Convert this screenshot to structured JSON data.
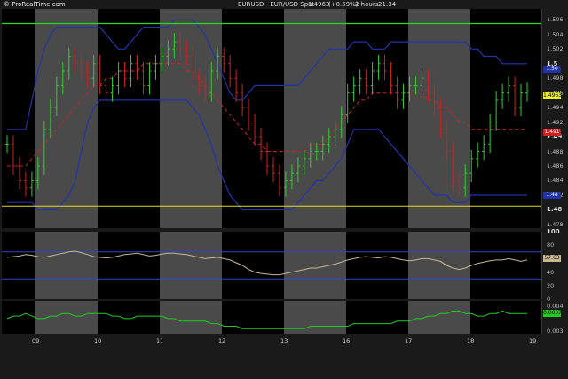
{
  "header": {
    "watermark": "© ProRealTime.com",
    "symbol": "EURUSD - EUR/USD Spot",
    "last": "1.4963",
    "change": "(+0.59%)",
    "timeframe": "2 hours",
    "time": "21:34"
  },
  "price_axis": {
    "ticks": [
      "1.506",
      "1.504",
      "1.502",
      "1.5",
      "1.498",
      "1.496",
      "1.494",
      "1.492",
      "1.49",
      "1.488",
      "1.486",
      "1.484",
      "1.482",
      "1.48",
      "1.478"
    ],
    "badges": {
      "upper_band": "1.50",
      "last": "1.4963",
      "ma": "1.491",
      "lower_band": "1.48"
    }
  },
  "osc1_axis": {
    "ticks": [
      "100",
      "80",
      "60",
      "40",
      "20",
      "0"
    ],
    "badge": "57.63"
  },
  "osc2_axis": {
    "ticks": [
      "0.004",
      "0.003"
    ],
    "badge": "0.0037"
  },
  "x_axis": {
    "labels": [
      "09",
      "10",
      "11",
      "12",
      "13",
      "16",
      "17",
      "18",
      "19"
    ]
  },
  "colors": {
    "background": "#000000",
    "session_band": "#4a4a4a",
    "up_candle": "#33cc33",
    "down_candle": "#cc2222",
    "bollinger": "#2233aa",
    "moving_average": "#cc2222",
    "oscillator": "#c8b890",
    "momentum": "#22cc22",
    "hline_green": "#22dd22",
    "hline_yellow": "#dddd22"
  },
  "chart_data": {
    "type": "line",
    "title": "EURUSD - EUR/USD Spot",
    "ylim": [
      1.4775,
      1.5075
    ],
    "days": [
      "09",
      "10",
      "11",
      "12",
      "13",
      "16",
      "17",
      "18",
      "19"
    ],
    "close": [
      1.489,
      1.486,
      1.484,
      1.483,
      1.484,
      1.486,
      1.491,
      1.494,
      1.497,
      1.499,
      1.501,
      1.5,
      1.499,
      1.498,
      1.5,
      1.497,
      1.496,
      1.497,
      1.499,
      1.498,
      1.5,
      1.499,
      1.497,
      1.499,
      1.5,
      1.501,
      1.502,
      1.503,
      1.502,
      1.501,
      1.498,
      1.497,
      1.496,
      1.499,
      1.501,
      1.5,
      1.498,
      1.496,
      1.494,
      1.492,
      1.49,
      1.488,
      1.486,
      1.485,
      1.483,
      1.484,
      1.485,
      1.486,
      1.487,
      1.488,
      1.488,
      1.489,
      1.49,
      1.491,
      1.493,
      1.496,
      1.497,
      1.498,
      1.497,
      1.499,
      1.5,
      1.499,
      1.497,
      1.495,
      1.496,
      1.497,
      1.497,
      1.498,
      1.496,
      1.494,
      1.491,
      1.488,
      1.484,
      1.483,
      1.485,
      1.487,
      1.488,
      1.489,
      1.492,
      1.495,
      1.496,
      1.497,
      1.494,
      1.496,
      1.4963
    ],
    "upper_band": [
      1.491,
      1.491,
      1.491,
      1.491,
      1.495,
      1.499,
      1.502,
      1.504,
      1.505,
      1.505,
      1.505,
      1.505,
      1.505,
      1.505,
      1.505,
      1.505,
      1.504,
      1.503,
      1.502,
      1.502,
      1.503,
      1.504,
      1.505,
      1.505,
      1.505,
      1.505,
      1.505,
      1.506,
      1.506,
      1.506,
      1.506,
      1.505,
      1.504,
      1.502,
      1.5,
      1.498,
      1.496,
      1.495,
      1.495,
      1.496,
      1.497,
      1.497,
      1.497,
      1.497,
      1.497,
      1.497,
      1.497,
      1.497,
      1.498,
      1.499,
      1.5,
      1.501,
      1.502,
      1.502,
      1.502,
      1.502,
      1.503,
      1.503,
      1.503,
      1.502,
      1.502,
      1.502,
      1.503,
      1.503,
      1.503,
      1.503,
      1.503,
      1.503,
      1.503,
      1.503,
      1.503,
      1.503,
      1.503,
      1.503,
      1.503,
      1.502,
      1.502,
      1.501,
      1.501,
      1.501,
      1.5,
      1.5,
      1.5,
      1.5,
      1.5
    ],
    "lower_band": [
      1.481,
      1.481,
      1.481,
      1.481,
      1.481,
      1.48,
      1.48,
      1.48,
      1.48,
      1.481,
      1.482,
      1.484,
      1.488,
      1.492,
      1.494,
      1.495,
      1.495,
      1.495,
      1.495,
      1.495,
      1.495,
      1.495,
      1.495,
      1.495,
      1.495,
      1.495,
      1.495,
      1.495,
      1.495,
      1.495,
      1.494,
      1.493,
      1.491,
      1.489,
      1.486,
      1.484,
      1.482,
      1.481,
      1.48,
      1.48,
      1.48,
      1.48,
      1.48,
      1.48,
      1.48,
      1.48,
      1.48,
      1.481,
      1.482,
      1.483,
      1.484,
      1.484,
      1.485,
      1.486,
      1.487,
      1.489,
      1.491,
      1.491,
      1.491,
      1.491,
      1.491,
      1.49,
      1.489,
      1.488,
      1.487,
      1.486,
      1.485,
      1.484,
      1.483,
      1.482,
      1.482,
      1.482,
      1.481,
      1.481,
      1.481,
      1.482,
      1.482,
      1.482,
      1.482,
      1.482,
      1.482,
      1.482,
      1.482,
      1.482,
      1.482
    ],
    "ma": [
      1.486,
      1.486,
      1.486,
      1.486,
      1.487,
      1.488,
      1.489,
      1.49,
      1.491,
      1.492,
      1.493,
      1.494,
      1.495,
      1.496,
      1.497,
      1.497,
      1.498,
      1.498,
      1.499,
      1.499,
      1.499,
      1.499,
      1.5,
      1.5,
      1.5,
      1.5,
      1.5,
      1.5,
      1.5,
      1.499,
      1.499,
      1.498,
      1.497,
      1.496,
      1.495,
      1.494,
      1.493,
      1.492,
      1.491,
      1.49,
      1.489,
      1.489,
      1.488,
      1.488,
      1.488,
      1.488,
      1.488,
      1.488,
      1.488,
      1.489,
      1.489,
      1.489,
      1.49,
      1.491,
      1.492,
      1.493,
      1.494,
      1.495,
      1.495,
      1.496,
      1.496,
      1.496,
      1.496,
      1.496,
      1.496,
      1.496,
      1.496,
      1.496,
      1.495,
      1.495,
      1.494,
      1.494,
      1.493,
      1.492,
      1.492,
      1.491,
      1.491,
      1.491,
      1.491,
      1.491,
      1.491,
      1.491,
      1.491,
      1.491,
      1.491
    ],
    "hlines": [
      1.5055,
      1.4805
    ],
    "osc1": [
      62,
      63,
      64,
      66,
      65,
      63,
      62,
      64,
      66,
      68,
      70,
      71,
      69,
      66,
      63,
      62,
      61,
      62,
      64,
      66,
      67,
      68,
      66,
      64,
      65,
      67,
      68,
      68,
      67,
      66,
      64,
      62,
      60,
      61,
      62,
      60,
      58,
      54,
      50,
      44,
      40,
      38,
      37,
      36,
      36,
      38,
      40,
      42,
      44,
      46,
      46,
      48,
      50,
      52,
      55,
      58,
      60,
      62,
      63,
      62,
      61,
      63,
      62,
      60,
      58,
      57,
      58,
      60,
      60,
      58,
      56,
      50,
      46,
      44,
      46,
      50,
      53,
      55,
      57,
      58,
      58,
      60,
      58,
      56,
      58
    ],
    "osc1_levels": [
      70,
      30
    ],
    "osc2": [
      0.0035,
      0.0036,
      0.0036,
      0.0037,
      0.0036,
      0.0035,
      0.0035,
      0.0036,
      0.0036,
      0.0037,
      0.0037,
      0.0036,
      0.0036,
      0.0037,
      0.0037,
      0.0037,
      0.0037,
      0.0036,
      0.0036,
      0.0035,
      0.0035,
      0.0036,
      0.0036,
      0.0036,
      0.0036,
      0.0036,
      0.0035,
      0.0035,
      0.0034,
      0.0034,
      0.0034,
      0.0034,
      0.0034,
      0.0033,
      0.0033,
      0.0032,
      0.0032,
      0.0032,
      0.0031,
      0.0031,
      0.0031,
      0.0031,
      0.0031,
      0.0031,
      0.0031,
      0.0031,
      0.0031,
      0.0031,
      0.0031,
      0.0032,
      0.0032,
      0.0032,
      0.0032,
      0.0032,
      0.0032,
      0.0032,
      0.0033,
      0.0033,
      0.0033,
      0.0033,
      0.0033,
      0.0033,
      0.0033,
      0.0034,
      0.0034,
      0.0034,
      0.0035,
      0.0035,
      0.0036,
      0.0036,
      0.0037,
      0.0037,
      0.0038,
      0.0038,
      0.0037,
      0.0037,
      0.0036,
      0.0036,
      0.0037,
      0.0037,
      0.0038,
      0.0037,
      0.0037,
      0.0037,
      0.0037
    ],
    "osc2_ylim": [
      0.0029,
      0.0042
    ]
  }
}
